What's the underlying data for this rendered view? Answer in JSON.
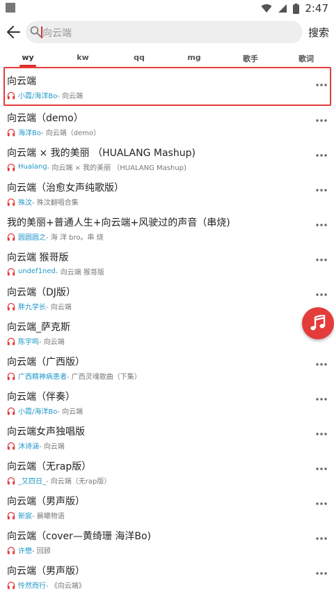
{
  "status": {
    "time": "2:47"
  },
  "search": {
    "query": "向云端",
    "button_label": "搜索"
  },
  "tabs": [
    {
      "label": "wy",
      "active": true
    },
    {
      "label": "kw"
    },
    {
      "label": "qq"
    },
    {
      "label": "mg"
    },
    {
      "label": "歌手"
    },
    {
      "label": "歌词"
    }
  ],
  "songs": [
    {
      "title": "向云端",
      "artist": "小霞/海洋Bo",
      "album": " - 向云端"
    },
    {
      "title": "向云端（demo）",
      "artist": "海洋Bo",
      "album": " - 向云端（demo）"
    },
    {
      "title": "向云端 × 我的美丽 （HUALANG Mashup)",
      "artist": "Hualang",
      "album": " - 向云端 × 我的美丽 （HUALANG Mashup)"
    },
    {
      "title": "向云端（治愈女声纯歌版）",
      "artist": "殊汶",
      "album": " - 殊汶翻唱合集"
    },
    {
      "title": "我的美丽+普通人生+向云端+风驶过的声音（串烧)",
      "artist": "圆圆圆之",
      "album": " - 海 洋 bro。串 烧"
    },
    {
      "title": "向云端 猴哥版",
      "artist": "undef1ned",
      "album": " - 向云端 猴哥版"
    },
    {
      "title": "向云端（DJ版）",
      "artist": "胖九学长",
      "album": " - 向云端"
    },
    {
      "title": "向云端_萨克斯",
      "artist": "陈宇鸣",
      "album": " - 向云端"
    },
    {
      "title": "向云端（广西版）",
      "artist": "广西精神病患者",
      "album": " - 广西灵魂歌曲（下集）"
    },
    {
      "title": "向云端（伴奏）",
      "artist": "小霞/海洋Bo",
      "album": " - 向云端"
    },
    {
      "title": "向云端女声独唱版",
      "artist": "沐诗涵",
      "album": " - 向云端"
    },
    {
      "title": "向云端（无rap版）",
      "artist": "_又四日_",
      "album": " - 向云端（无rap版）"
    },
    {
      "title": "向云端（男声版）",
      "artist": "新宸",
      "album": " - 晨曦物语"
    },
    {
      "title": "向云端（cover—黄绮珊 海洋Bo)",
      "artist": "许懋",
      "album": " - 回顾"
    },
    {
      "title": "向云端（男声版）",
      "artist": "怜然而行",
      "album": " - 《向云端》"
    }
  ],
  "colors": {
    "accent": "#e43b3b",
    "artist": "#1f97c8"
  }
}
